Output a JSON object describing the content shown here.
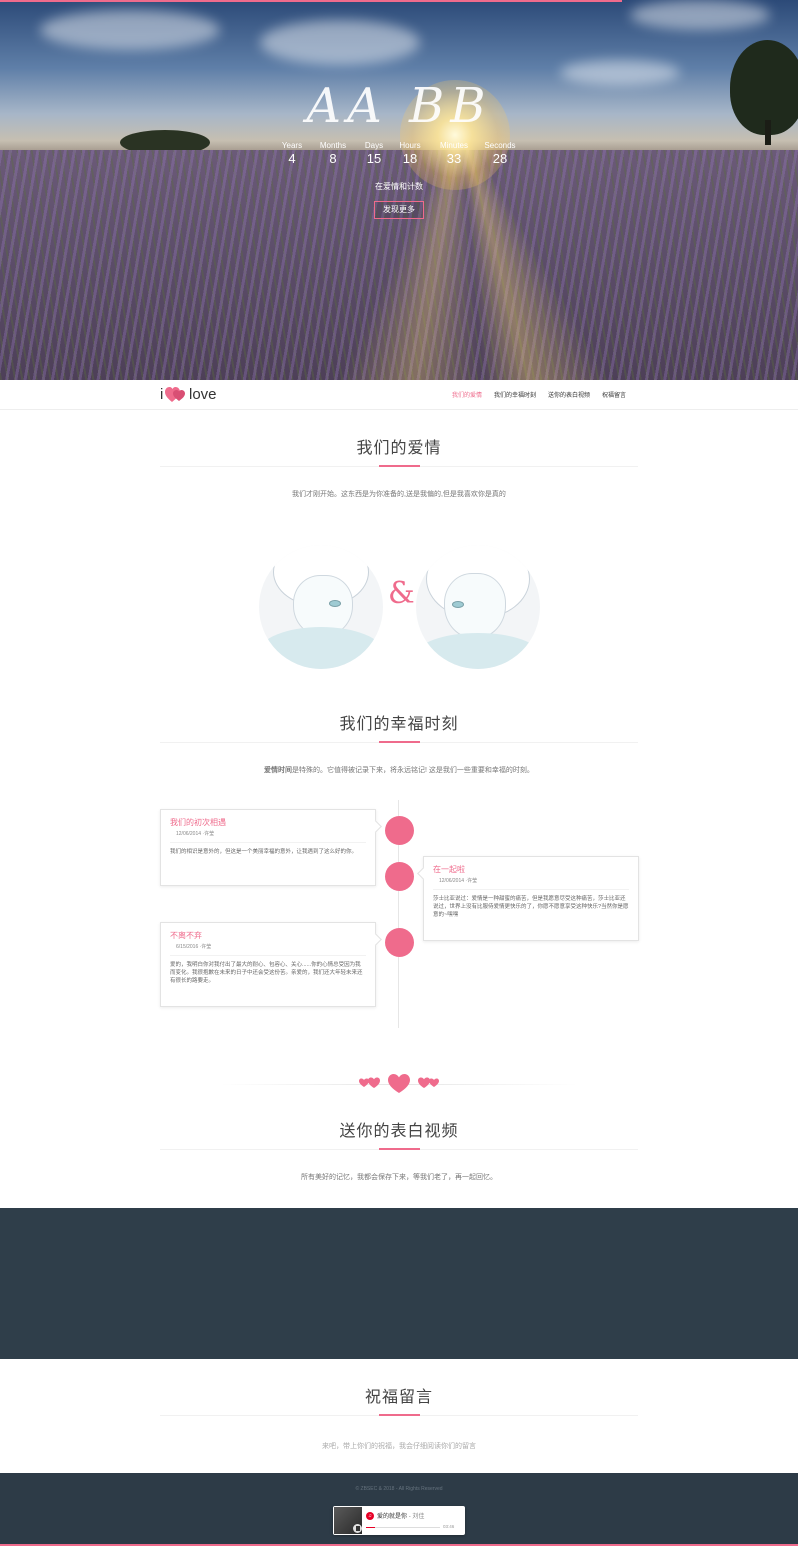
{
  "hero": {
    "names": "AA  BB",
    "countdown": [
      {
        "label": "Years",
        "value": "4"
      },
      {
        "label": "Months",
        "value": "8"
      },
      {
        "label": "Days",
        "value": "15"
      },
      {
        "label": "Hours",
        "value": "18"
      },
      {
        "label": "Minutes",
        "value": "33"
      },
      {
        "label": "Seconds",
        "value": "28"
      }
    ],
    "caption": "在爱情和计数",
    "button_label": "发现更多",
    "scroll_progress": 0.78,
    "accent_color": "#ef6b8c"
  },
  "nav": {
    "logo_i": "i",
    "logo_love": "love",
    "logo_heart_icon": "heart-icon",
    "links": [
      {
        "label": "我们的爱情",
        "active": true
      },
      {
        "label": "我们的幸福时刻",
        "active": false
      },
      {
        "label": "送你的表白视频",
        "active": false
      },
      {
        "label": "祝福留言",
        "active": false
      }
    ]
  },
  "love": {
    "title": "我们的爱情",
    "subtitle": "我们才刚开始。这东西是为你准备的,送是我偏的,但是我喜欢你是真的",
    "ampersand": "&"
  },
  "moments": {
    "title": "我们的幸福时刻",
    "subtitle_strong": "爱情时间",
    "subtitle": "是特殊的。它值得被记录下来，将永远铭记! 这是我们一些重要和幸福的时刻。",
    "items": [
      {
        "title": "我们的初次相遇",
        "meta": "12/06/2014 ·许莹",
        "text": "我们的相识是意外的，但这是一个美丽幸福的意外，让我遇到了这么好的你。"
      },
      {
        "title": "在一起啦",
        "meta": "12/06/2014 ·许莹",
        "text": "莎士比亚说过：爱情是一种甜蜜的痛苦，但是我愿意尽受这种痛苦，莎士比亚还说过，世界上没有比服侍爱情更快乐的了，你愿不愿意享受这种快乐?当然你是愿意的~嘿嘿"
      },
      {
        "title": "不离不弃",
        "meta": "6/15/2016 ·许莹",
        "text": "爱的，我明白你对我付出了最大的耐心、包容心、关心......你的心情总受因为我而变化。我很抱歉在未来的日子中还会受这份苦。亲爱的，我们还大年轻未来还有很长的路要走。"
      }
    ]
  },
  "video": {
    "title": "送你的表白视频",
    "subtitle": "所有美好的记忆，我都会保存下来，等我们老了，再一起回忆。"
  },
  "wishes": {
    "title": "祝福留言",
    "subtitle": "来吧，带上你们的祝福，我会仔细阅读你们的留言"
  },
  "footer": {
    "copyright": "© ZBSEC & 2018 - All Rights Reserved",
    "player": {
      "logo_icon": "music-logo-icon",
      "song": "爱的就是你",
      "artist": "- 刘佳",
      "time": "03:46",
      "progress": 0.12
    }
  }
}
